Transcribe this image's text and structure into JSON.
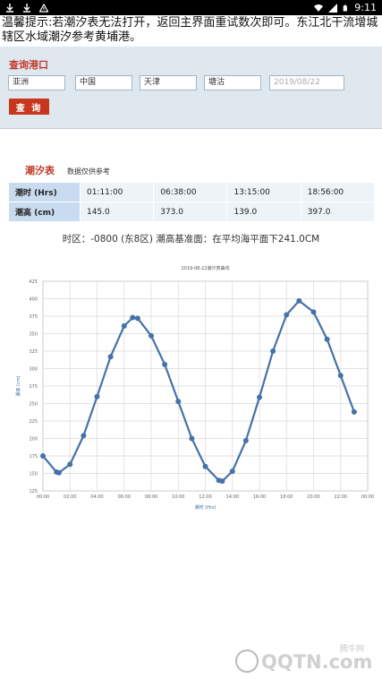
{
  "status_bar": {
    "time": "9:11",
    "left_icons": [
      "download-icon",
      "download-icon",
      "warning-icon"
    ],
    "right_icons": [
      "wifi-icon",
      "signal-icon",
      "battery-icon"
    ]
  },
  "notice_text": "温馨提示:若潮汐表无法打开，返回主界面重试数次即可。东江北干流增城辖区水域潮汐参考黄埔港。",
  "query": {
    "title": "查询港口",
    "continent": "亚洲",
    "country": "中国",
    "city": "天津",
    "port": "塘沽",
    "date_placeholder": "2019/08/22",
    "button_label": "查 询"
  },
  "tide": {
    "title": "潮汐表",
    "note": "数据仅供参考",
    "row_time_label": "潮时 (Hrs)",
    "row_height_label": "潮高 (cm)",
    "times": [
      "01:11:00",
      "06:38:00",
      "13:15:00",
      "18:56:00"
    ],
    "heights": [
      "145.0",
      "373.0",
      "139.0",
      "397.0"
    ],
    "zone_info": "时区：-0800 (东8区) 潮高基准面：在平均海平面下241.0CM"
  },
  "chart_data": {
    "type": "line",
    "title": "2019-08-22潮汐表曲线",
    "xlabel": "潮时 (Hrs)",
    "ylabel": "潮高 (cm)",
    "x_tick_labels": [
      "00:00",
      "02:00",
      "04:00",
      "06:00",
      "08:00",
      "10:00",
      "12:00",
      "14:00",
      "16:00",
      "18:00",
      "20:00",
      "22:00",
      "00:00"
    ],
    "ylim": [
      125,
      425
    ],
    "y_ticks": [
      125,
      150,
      175,
      200,
      225,
      250,
      275,
      300,
      325,
      350,
      375,
      400,
      425
    ],
    "grid": true,
    "x": [
      0,
      1,
      1.18,
      2,
      3,
      4,
      5,
      6,
      6.63,
      7,
      8,
      9,
      10,
      11,
      12,
      13,
      13.25,
      14,
      15,
      16,
      17,
      18,
      18.93,
      20,
      21,
      22,
      23
    ],
    "values": [
      175,
      152,
      151,
      163,
      204,
      260,
      317,
      361,
      373,
      372,
      347,
      306,
      253,
      200,
      160,
      140,
      139,
      153,
      197,
      259,
      325,
      377,
      397,
      381,
      342,
      290,
      238
    ],
    "color": "#4572a7"
  },
  "watermark": {
    "brand": "QQTN.com",
    "sub": "腾牛网"
  }
}
